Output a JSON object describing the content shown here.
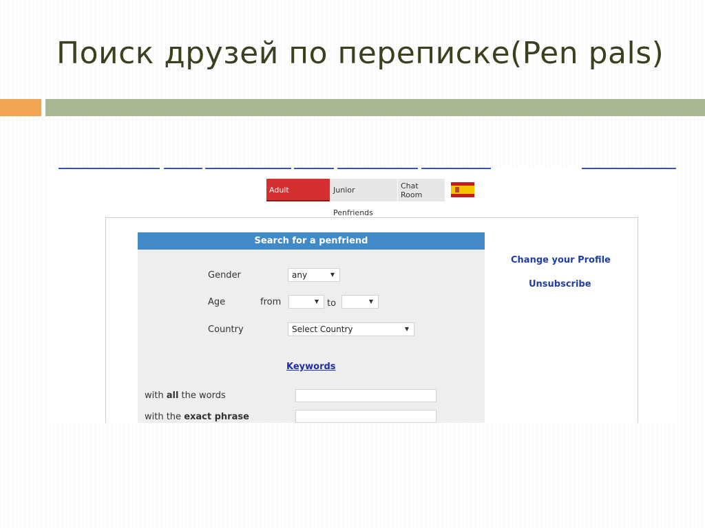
{
  "slide": {
    "title": "Поиск друзей по переписке(Pen pals)"
  },
  "colors": {
    "accent_orange": "#f0a550",
    "accent_green": "#a9b892",
    "tab_active": "#d62f2f",
    "panel_header": "#4289c8",
    "link": "#1f3ca8"
  },
  "tabs": {
    "adult": "Adult Penfriends",
    "junior": "Junior Penfriends",
    "chat": "Chat Room"
  },
  "flag_icon": "spain-flag-icon",
  "search": {
    "header": "Search for a penfriend",
    "gender_label": "Gender",
    "gender_value": "any",
    "age_label": "Age",
    "age_from_label": "from",
    "age_to_label": "to",
    "age_from_value": "",
    "age_to_value": "",
    "country_label": "Country",
    "country_value": "Select Country",
    "keywords_link": "Keywords",
    "all_words_prefix": "with ",
    "all_words_bold": "all",
    "all_words_suffix": " the words",
    "exact_phrase_prefix": "with the ",
    "exact_phrase_bold": "exact phrase",
    "all_words_value": "",
    "exact_phrase_value": ""
  },
  "sidebar": {
    "change_profile": "Change your Profile",
    "unsubscribe": "Unsubscribe"
  }
}
